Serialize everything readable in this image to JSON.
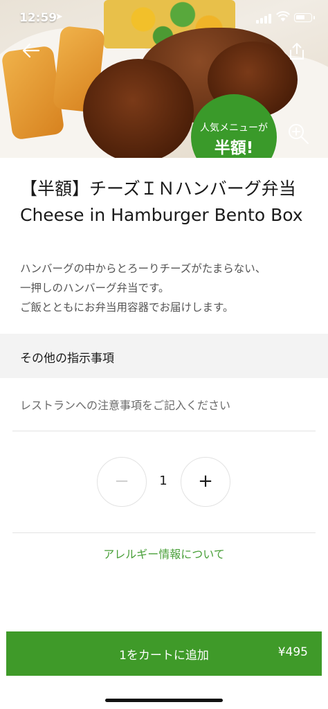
{
  "status_bar": {
    "time": "12:59",
    "location_glyph": "➤"
  },
  "hero": {
    "promo_line1": "人気メニューが",
    "promo_line2": "半額!",
    "back_icon": "arrow-left-icon",
    "share_icon": "share-icon",
    "zoom_icon": "zoom-in-icon"
  },
  "item": {
    "title": "【半額】チーズＩＮハンバーグ弁当 Cheese in Hamburger Bento Box",
    "description": "ハンバーグの中からとろーりチーズがたまらない、\n一押しのハンバーグ弁当です。\nご飯とともにお弁当用容器でお届けします。"
  },
  "instructions": {
    "heading": "その他の指示事項",
    "placeholder": "レストランへの注意事項をご記入ください",
    "value": ""
  },
  "quantity": {
    "minus": "−",
    "value": "1",
    "plus": "+"
  },
  "allergy_link": "アレルギー情報について",
  "cart": {
    "label": "1をカートに追加",
    "price": "¥495"
  },
  "colors": {
    "accent_green": "#3f9a29",
    "link_green": "#4aa03a",
    "promo_green": "#3a9a2a"
  }
}
